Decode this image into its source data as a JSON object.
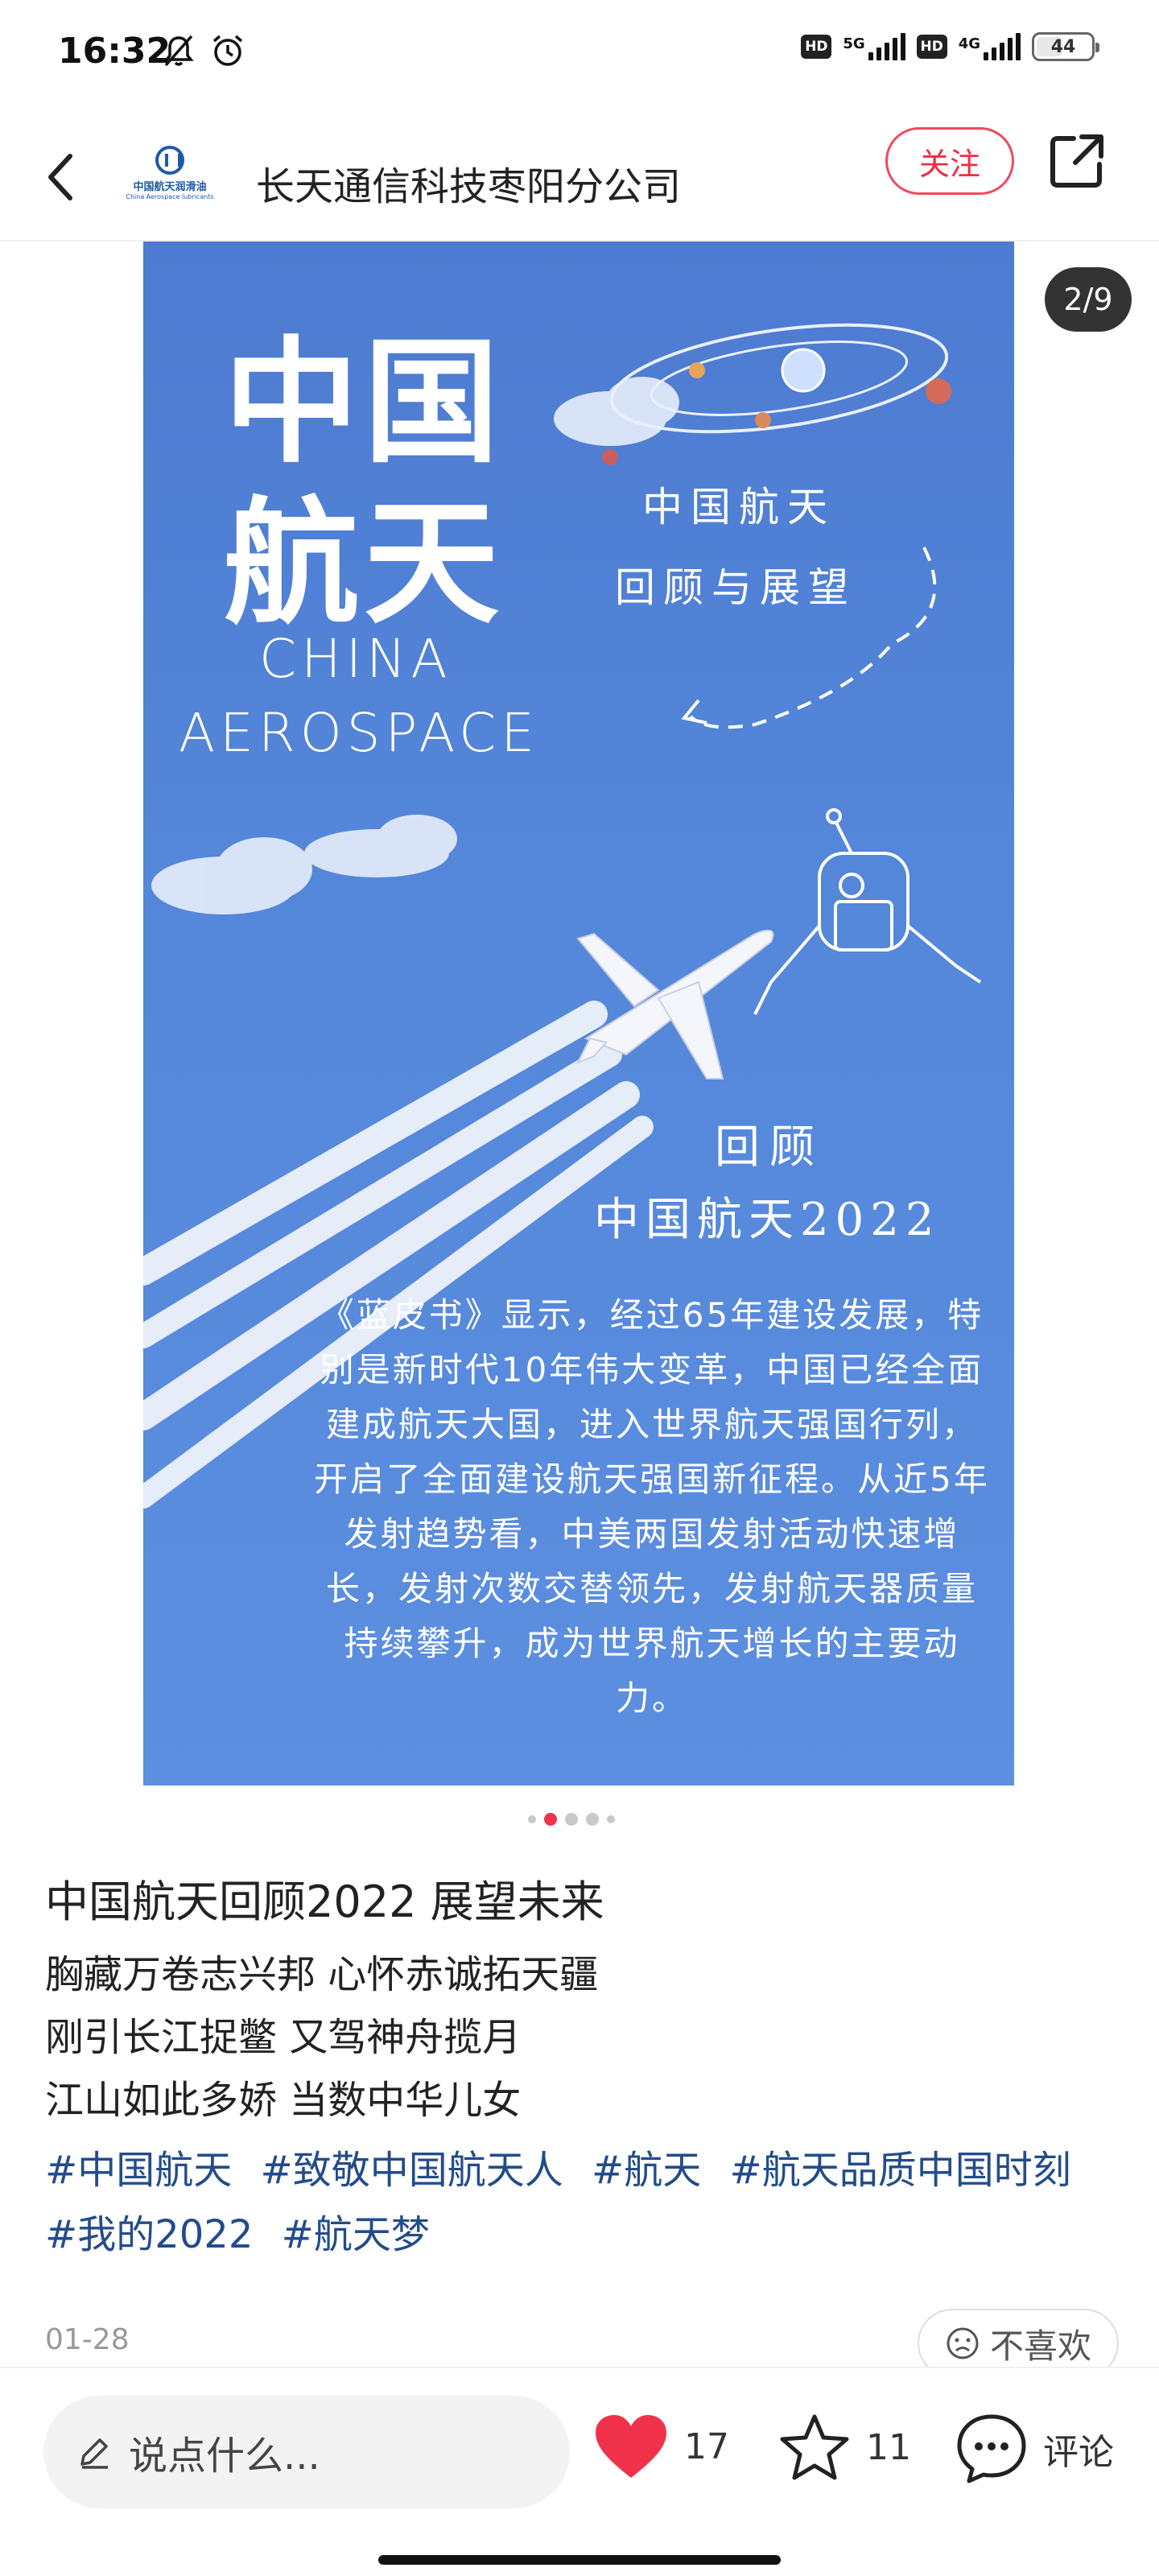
{
  "status_bar": {
    "time": "16:32",
    "hd1": "HD",
    "network1": "5G",
    "hd2": "HD",
    "network2": "4G",
    "battery": "44"
  },
  "header": {
    "logo_text": "中国航天润滑油",
    "logo_sub": "China Aerospace lubricants",
    "account_name": "长天通信科技枣阳分公司",
    "follow_label": "关注"
  },
  "image": {
    "page_counter": "2/9",
    "dot_count": 5,
    "active_dot": 2,
    "poster": {
      "title_line1": "中国",
      "title_line2": "航天",
      "en_line1": "CHINA",
      "en_line2": "AEROSPACE",
      "hand_line1": "中国航天",
      "hand_line2": "回顾与展望",
      "hand_line3": "回顾",
      "hand_line4": "中国航天2022",
      "body": "《蓝皮书》显示，经过65年建设发展，特别是新时代10年伟大变革，中国已经全面建成航天大国，进入世界航天强国行列，开启了全面建设航天强国新征程。从近5年发射趋势看，中美两国发射活动快速增长，发射次数交替领先，发射航天器质量持续攀升，成为世界航天增长的主要动力。"
    }
  },
  "post": {
    "title": "中国航天回顾2022 展望未来",
    "lines": [
      "胸藏万卷志兴邦 心怀赤诚拓天疆",
      "刚引长江捉鳖 又驾神舟揽月",
      "江山如此多娇 当数中华儿女"
    ],
    "hashtags": [
      "#中国航天",
      "#致敬中国航天人",
      "#航天",
      "#航天品质中国时刻",
      "#我的2022",
      "#航天梦"
    ],
    "date": "01-28",
    "dislike_label": "不喜欢"
  },
  "bottom_bar": {
    "comment_placeholder": "说点什么...",
    "like_count": "17",
    "fav_count": "11",
    "comment_label": "评论"
  },
  "colors": {
    "accent": "#f0324a",
    "hashtag": "#234c8a",
    "poster_bg": "#5486d9"
  }
}
